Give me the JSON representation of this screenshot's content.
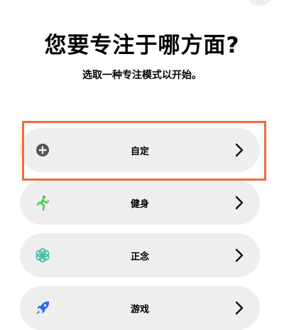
{
  "header": {
    "title": "您要专注于哪方面?",
    "subtitle": "选取一种专注模式以开始。"
  },
  "focus_modes": [
    {
      "label": "自定",
      "icon": "plus-circle-icon",
      "icon_color": "#555555"
    },
    {
      "label": "健身",
      "icon": "running-figure-icon",
      "icon_color": "#3ecf3e"
    },
    {
      "label": "正念",
      "icon": "mindfulness-flower-icon",
      "icon_color": "#3cbfa4"
    },
    {
      "label": "游戏",
      "icon": "rocket-icon",
      "icon_color": "#1e6ef0"
    }
  ],
  "colors": {
    "highlight": "#f26b3a",
    "row_background": "#eeeeef"
  }
}
